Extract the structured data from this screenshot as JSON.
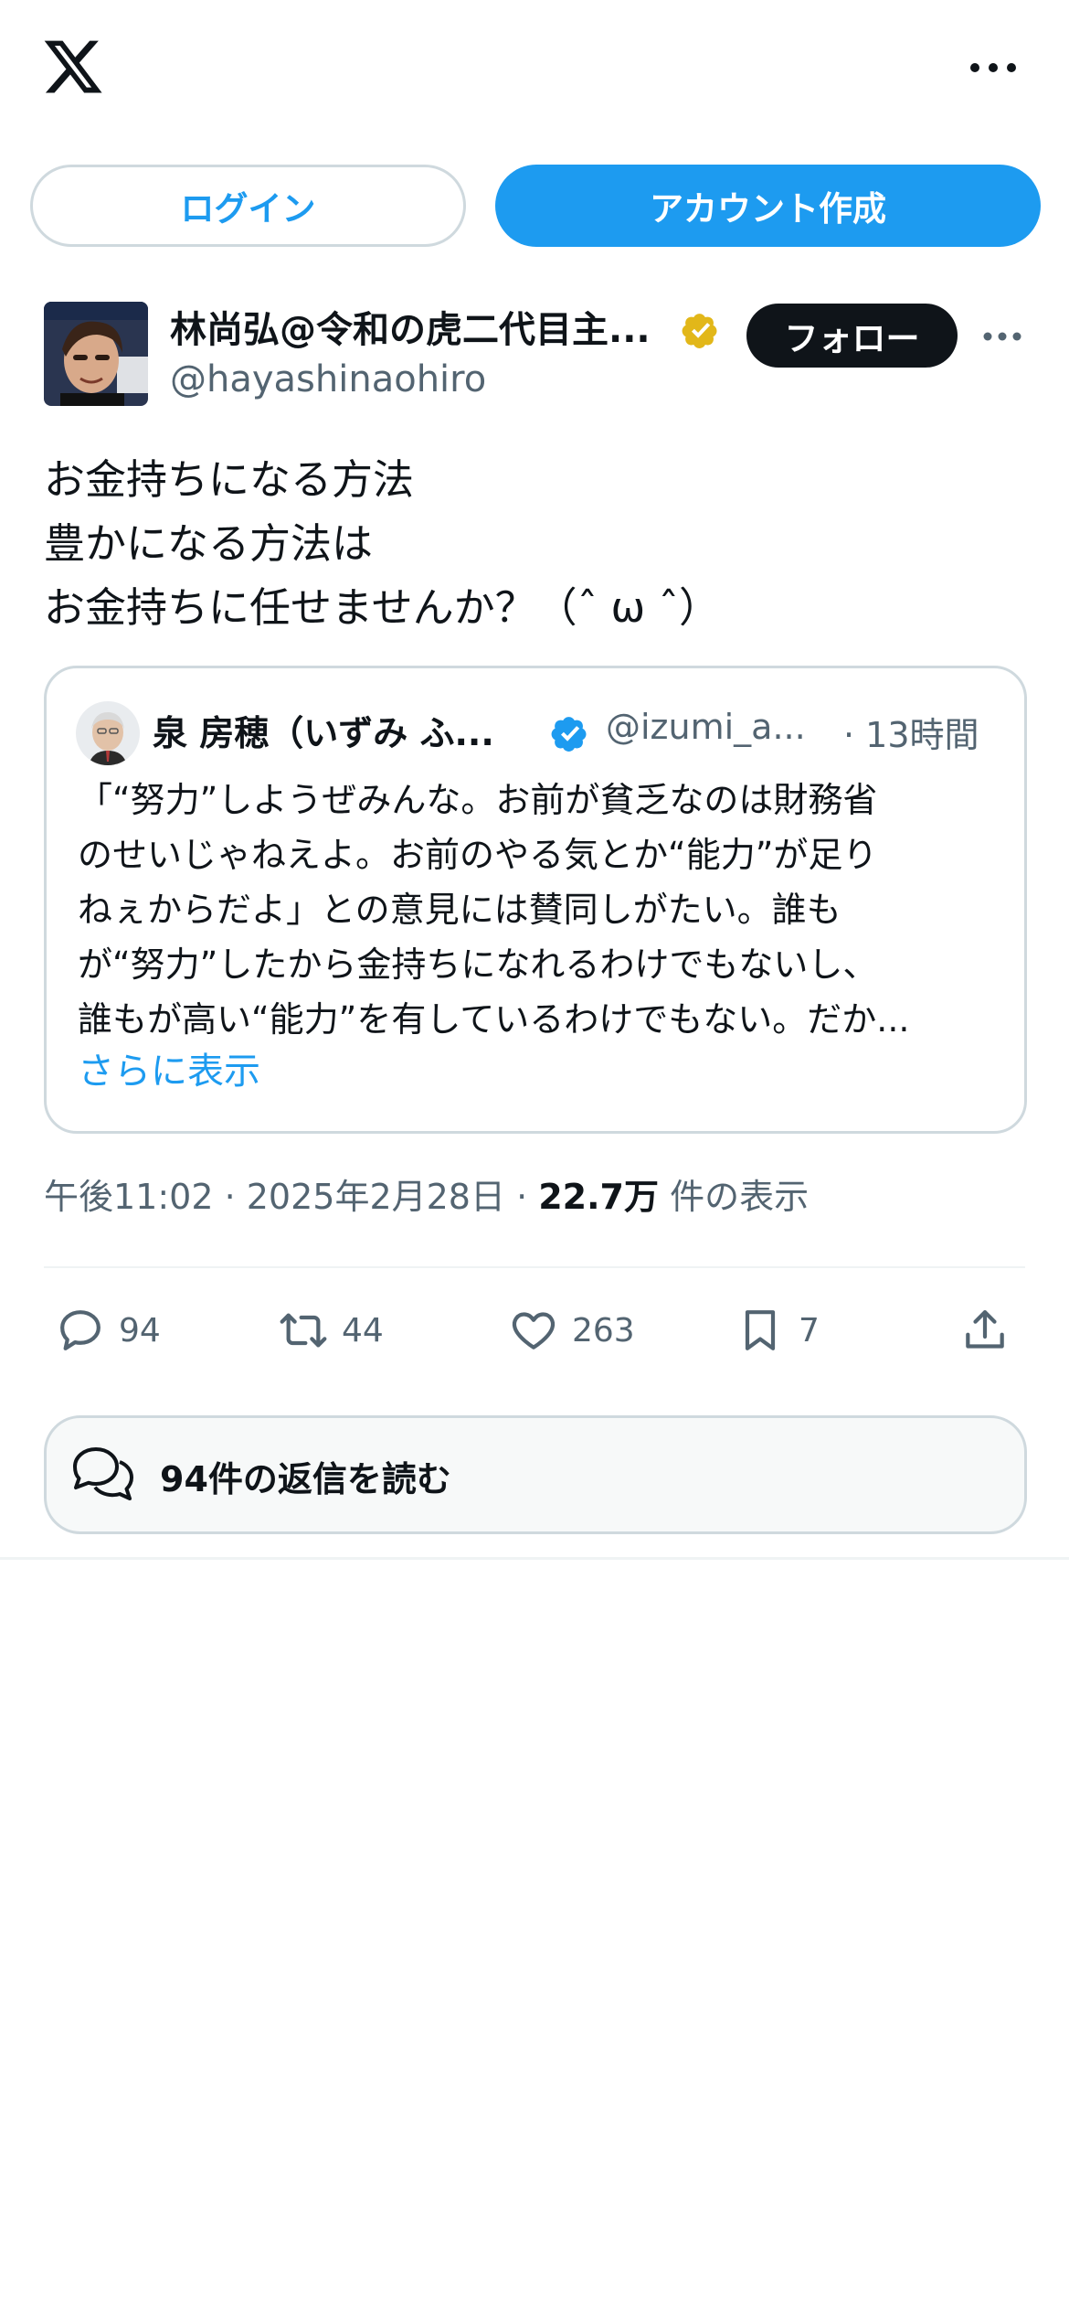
{
  "header": {
    "logo_icon": "x-logo-icon",
    "more_icon": "more-horizontal-icon"
  },
  "auth": {
    "login_label": "ログイン",
    "signup_label": "アカウント作成"
  },
  "tweet": {
    "author_name": "林尚弘@令和の虎二代目主...",
    "author_handle": "@hayashinaohiro",
    "verified_badge": "gold-verified-icon",
    "follow_label": "フォロー",
    "text_lines": [
      "お金持ちになる方法",
      "豊かになる方法は",
      "お金持ちに任せませんか？（ˆ ω ˆ）"
    ],
    "quote": {
      "name": "泉 房穂（いずみ ふ...",
      "handle": "@izumi_a...",
      "time": "· 13時間",
      "badge": "blue-verified-icon",
      "body_lines": [
        "「“努力”しようぜみんな。お前が貧乏なのは財務省",
        "のせいじゃねえよ。お前のやる気とか“能力”が足り",
        "ねぇからだよ」との意見には賛同しがたい。誰も",
        "が“努力”したから金持ちになれるわけでもないし、",
        "誰もが高い“能力”を有しているわけでもない。だか..."
      ],
      "show_more": "さらに表示"
    },
    "timestamp": "午後11:02 · 2025年2月28日 · ",
    "views_value": "22.7万",
    "views_label": " 件の表示",
    "actions": {
      "reply_count": "94",
      "retweet_count": "44",
      "like_count": "263",
      "bookmark_count": "7"
    },
    "read_replies": "94件の返信を読む"
  },
  "colors": {
    "accent": "#1d9bf0",
    "text_primary": "#0f1419",
    "text_secondary": "#536471",
    "border": "#cfd9de",
    "gold_badge": "#e2b719"
  }
}
